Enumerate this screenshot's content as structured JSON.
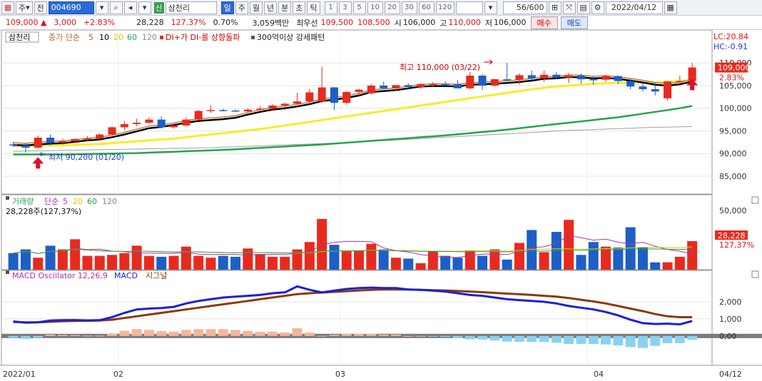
{
  "toolbar": {
    "type_label": "주",
    "jeon_label": "전",
    "code": "004690",
    "sin_label": "신",
    "stock_name": "삼천리",
    "periods": [
      "일",
      "주",
      "월",
      "년",
      "분",
      "초",
      "틱"
    ],
    "active_period": "일",
    "intervals": [
      "1",
      "3",
      "5",
      "10",
      "20",
      "30",
      "60",
      "120"
    ],
    "count": "56/600",
    "date": "2022/04/12"
  },
  "quote": {
    "price": "109,000",
    "change": "3,000",
    "change_pct": "+2.83%",
    "volume": "28,228",
    "volume_ratio": "127.37%",
    "turnover_pct": "0.70%",
    "amount": "3,059백만",
    "best_label": "최우선",
    "best_ask": "109,500",
    "best_bid": "108,500",
    "open_label": "시",
    "open": "106,000",
    "high_label": "고",
    "high": "110,000",
    "low_label": "저",
    "low": "106,000",
    "buy_label": "매수",
    "sell_label": "매도"
  },
  "colors": {
    "up": "#e82a1e",
    "down": "#1d5fc7",
    "ma5": "#000000",
    "ma20": "#f5ee2a",
    "ma60": "#2aa052",
    "ma120": "#a0a0a0",
    "ma10": "#b8622a",
    "macd": "#1a20d8",
    "signal": "#8a3a0a",
    "osc_pos": "#f5b79a",
    "osc_neg": "#8ad2f2"
  },
  "chart_data": [
    {
      "type": "candlestick",
      "legend": {
        "name": "삼천리",
        "ma_label": "종가 단순",
        "ma_periods": [
          "5",
          "10",
          "20",
          "60",
          "120"
        ],
        "dmi_label": "DI+가 DI-를 상향돌파",
        "pattern_label": "300억이상 강세패턴"
      },
      "lc_label": "LC:20.84",
      "hc_label": "HC:-0.91",
      "yticks": [
        "110,000",
        "105,000",
        "100,000",
        "95,000",
        "90,000",
        "85,000"
      ],
      "ylim": [
        82000,
        113500
      ],
      "last_price": "109,000",
      "last_pct": "2.83%",
      "annotations": {
        "max": "최고 110,000 (03/22)",
        "min": "최저 90,200 (01/20)"
      },
      "ohlc": [
        [
          92000,
          92600,
          91500,
          91800
        ],
        [
          91800,
          92400,
          90200,
          91300
        ],
        [
          91300,
          94000,
          91000,
          93500
        ],
        [
          93500,
          94200,
          91800,
          92400
        ],
        [
          92400,
          93300,
          92000,
          92700
        ],
        [
          92700,
          93400,
          92500,
          93200
        ],
        [
          93200,
          93900,
          92800,
          93300
        ],
        [
          93300,
          94500,
          93000,
          94200
        ],
        [
          94200,
          96000,
          94000,
          95800
        ],
        [
          95800,
          97200,
          95200,
          96500
        ],
        [
          96500,
          97700,
          96000,
          96800
        ],
        [
          96800,
          98000,
          96500,
          97500
        ],
        [
          97500,
          98200,
          95500,
          95800
        ],
        [
          95800,
          96600,
          95500,
          96200
        ],
        [
          96200,
          98000,
          96000,
          97500
        ],
        [
          97500,
          99600,
          97200,
          99400
        ],
        [
          99400,
          100600,
          99000,
          99600
        ],
        [
          99600,
          99900,
          99300,
          99500
        ],
        [
          99500,
          99700,
          99200,
          99300
        ],
        [
          99300,
          100000,
          99100,
          99700
        ],
        [
          99700,
          100500,
          99400,
          99900
        ],
        [
          99900,
          100900,
          99600,
          100600
        ],
        [
          100600,
          101200,
          99600,
          101000
        ],
        [
          101000,
          103400,
          100800,
          101500
        ],
        [
          101500,
          104200,
          101300,
          103500
        ],
        [
          101500,
          109200,
          101200,
          104600
        ],
        [
          104600,
          104700,
          99600,
          101200
        ],
        [
          101200,
          103800,
          100800,
          103600
        ],
        [
          103600,
          104300,
          102800,
          104100
        ],
        [
          103300,
          105400,
          103000,
          105000
        ],
        [
          105000,
          105900,
          104200,
          104400
        ],
        [
          104400,
          105100,
          103800,
          105100
        ],
        [
          105100,
          105500,
          104500,
          104700
        ],
        [
          104700,
          105500,
          104300,
          105300
        ],
        [
          105300,
          105800,
          104700,
          105400
        ],
        [
          105400,
          106000,
          105000,
          105300
        ],
        [
          105300,
          106200,
          104500,
          104400
        ],
        [
          104400,
          108000,
          104200,
          107200
        ],
        [
          107200,
          107500,
          104000,
          105000
        ],
        [
          105000,
          106500,
          104800,
          106400
        ],
        [
          106400,
          110000,
          106000,
          106300
        ],
        [
          106300,
          107700,
          105200,
          107300
        ],
        [
          107300,
          108300,
          106200,
          106600
        ],
        [
          106600,
          108300,
          105800,
          107400
        ],
        [
          107400,
          108000,
          106400,
          106800
        ],
        [
          106800,
          107800,
          105600,
          107200
        ],
        [
          107200,
          107700,
          105400,
          106400
        ],
        [
          106400,
          107000,
          105200,
          106300
        ],
        [
          106300,
          107400,
          105800,
          107100
        ],
        [
          107100,
          107300,
          105400,
          106000
        ],
        [
          106000,
          106600,
          104200,
          104800
        ],
        [
          104800,
          105500,
          103700,
          104200
        ],
        [
          104200,
          105600,
          102800,
          103700
        ],
        [
          102200,
          106000,
          101700,
          105900
        ],
        [
          105900,
          107200,
          105500,
          106000
        ],
        [
          106000,
          110000,
          106000,
          109000
        ]
      ],
      "ma5": [
        91900,
        91800,
        92000,
        92200,
        92300,
        92600,
        92900,
        93100,
        93600,
        94200,
        94900,
        95600,
        95900,
        96300,
        96800,
        97200,
        97400,
        97600,
        97900,
        98600,
        99200,
        99700,
        100000,
        100400,
        100900,
        101600,
        101900,
        102300,
        102800,
        103600,
        103800,
        104000,
        104400,
        104800,
        104900,
        104900,
        104800,
        105200,
        105300,
        105400,
        105600,
        105800,
        106100,
        106500,
        106600,
        106900,
        106800,
        106600,
        106700,
        106500,
        106100,
        105700,
        105200,
        105000,
        105300,
        105900
      ],
      "ma20": [
        91700,
        91700,
        91700,
        91800,
        91800,
        91900,
        92000,
        92100,
        92300,
        92500,
        92700,
        92900,
        93100,
        93300,
        93600,
        93900,
        94200,
        94500,
        94800,
        95100,
        95400,
        95800,
        96200,
        96600,
        97000,
        97400,
        97800,
        98200,
        98600,
        99000,
        99400,
        99800,
        100200,
        100600,
        101000,
        101400,
        101800,
        102200,
        102600,
        103000,
        103400,
        103800,
        104200,
        104500,
        104800,
        105000,
        105200,
        105400,
        105500,
        105600,
        105600,
        105600,
        105700,
        105800,
        106000,
        106200
      ],
      "ma60": [
        89800,
        89800,
        89800,
        89800,
        89800,
        89850,
        89900,
        89950,
        90000,
        90050,
        90100,
        90200,
        90300,
        90400,
        90500,
        90600,
        90700,
        90800,
        90950,
        91100,
        91250,
        91400,
        91550,
        91700,
        91850,
        92000,
        92200,
        92400,
        92600,
        92800,
        93000,
        93200,
        93400,
        93600,
        93800,
        94000,
        94250,
        94500,
        94750,
        95000,
        95300,
        95600,
        95900,
        96200,
        96500,
        96800,
        97100,
        97400,
        97700,
        98000,
        98400,
        98800,
        99200,
        99600,
        100000,
        100500
      ],
      "ma120": [
        90500,
        90550,
        90600,
        90650,
        90700,
        90750,
        90800,
        90850,
        90900,
        90950,
        91000,
        91050,
        91100,
        91150,
        91200,
        91250,
        91300,
        91400,
        91500,
        91600,
        91700,
        91800,
        91900,
        92000,
        92100,
        92200,
        92300,
        92400,
        92550,
        92700,
        92850,
        93000,
        93150,
        93300,
        93450,
        93600,
        93750,
        93900,
        94050,
        94200,
        94350,
        94500,
        94650,
        94800,
        94950,
        95100,
        95200,
        95300,
        95400,
        95500,
        95600,
        95700,
        95800,
        95850,
        95900,
        95950
      ],
      "date_labels": [
        "2022/01",
        "02",
        "03",
        "04",
        "04/12"
      ]
    },
    {
      "type": "bar",
      "title": "거래량",
      "ma_label": "단순",
      "ma_periods": [
        "5",
        "20",
        "60",
        "120"
      ],
      "info": "28,228주(127,37%)",
      "yticks": [
        "50,000"
      ],
      "ylim": [
        0,
        58000
      ],
      "last_value": "28,228",
      "last_pct": "127,37%",
      "values": [
        18000,
        22000,
        13000,
        26000,
        22000,
        33000,
        15000,
        15000,
        16000,
        18000,
        26000,
        15000,
        14000,
        15000,
        25000,
        15000,
        13000,
        15000,
        14000,
        23000,
        17000,
        14000,
        14000,
        22000,
        30000,
        55000,
        27000,
        20000,
        21000,
        28000,
        22000,
        13000,
        12000,
        7000,
        20000,
        15000,
        13000,
        21000,
        15000,
        22000,
        11000,
        29000,
        43000,
        19000,
        41000,
        54000,
        16000,
        30000,
        25000,
        24000,
        46000,
        24000,
        8000,
        8000,
        14000,
        31000
      ]
    },
    {
      "type": "line",
      "title": "MACD Oscillator 12,26,9",
      "series_names": [
        "MACD",
        "시그널"
      ],
      "yticks": [
        "2,000",
        "1,000",
        "0,00"
      ],
      "ylim": [
        -1300,
        3000
      ],
      "macd": [
        850,
        780,
        800,
        900,
        920,
        930,
        910,
        920,
        1100,
        1350,
        1550,
        1600,
        1630,
        1700,
        1900,
        2050,
        2150,
        2250,
        2300,
        2350,
        2400,
        2500,
        2550,
        2900,
        2700,
        2550,
        2650,
        2750,
        2800,
        2830,
        2800,
        2800,
        2720,
        2700,
        2650,
        2600,
        2500,
        2400,
        2350,
        2250,
        2150,
        2100,
        2050,
        2000,
        1900,
        1750,
        1650,
        1550,
        1400,
        1200,
        950,
        750,
        700,
        720,
        680,
        870
      ],
      "signal": [
        820,
        800,
        800,
        830,
        860,
        880,
        890,
        900,
        950,
        1050,
        1150,
        1250,
        1350,
        1450,
        1550,
        1650,
        1750,
        1850,
        1950,
        2050,
        2150,
        2250,
        2350,
        2450,
        2500,
        2540,
        2580,
        2620,
        2660,
        2700,
        2720,
        2720,
        2720,
        2700,
        2680,
        2660,
        2630,
        2600,
        2560,
        2520,
        2480,
        2440,
        2400,
        2350,
        2300,
        2220,
        2120,
        2020,
        1900,
        1750,
        1600,
        1450,
        1280,
        1150,
        1100,
        1100
      ],
      "osc": [
        -100,
        -180,
        -100,
        80,
        60,
        50,
        20,
        20,
        150,
        300,
        400,
        350,
        280,
        250,
        350,
        400,
        400,
        400,
        350,
        300,
        250,
        250,
        200,
        450,
        200,
        10,
        70,
        130,
        140,
        130,
        80,
        80,
        0,
        0,
        -30,
        -60,
        -130,
        -200,
        -210,
        -270,
        -330,
        -340,
        -350,
        -350,
        -400,
        -470,
        -470,
        -470,
        -500,
        -550,
        -650,
        -700,
        -580,
        -430,
        -420,
        -230
      ]
    }
  ]
}
